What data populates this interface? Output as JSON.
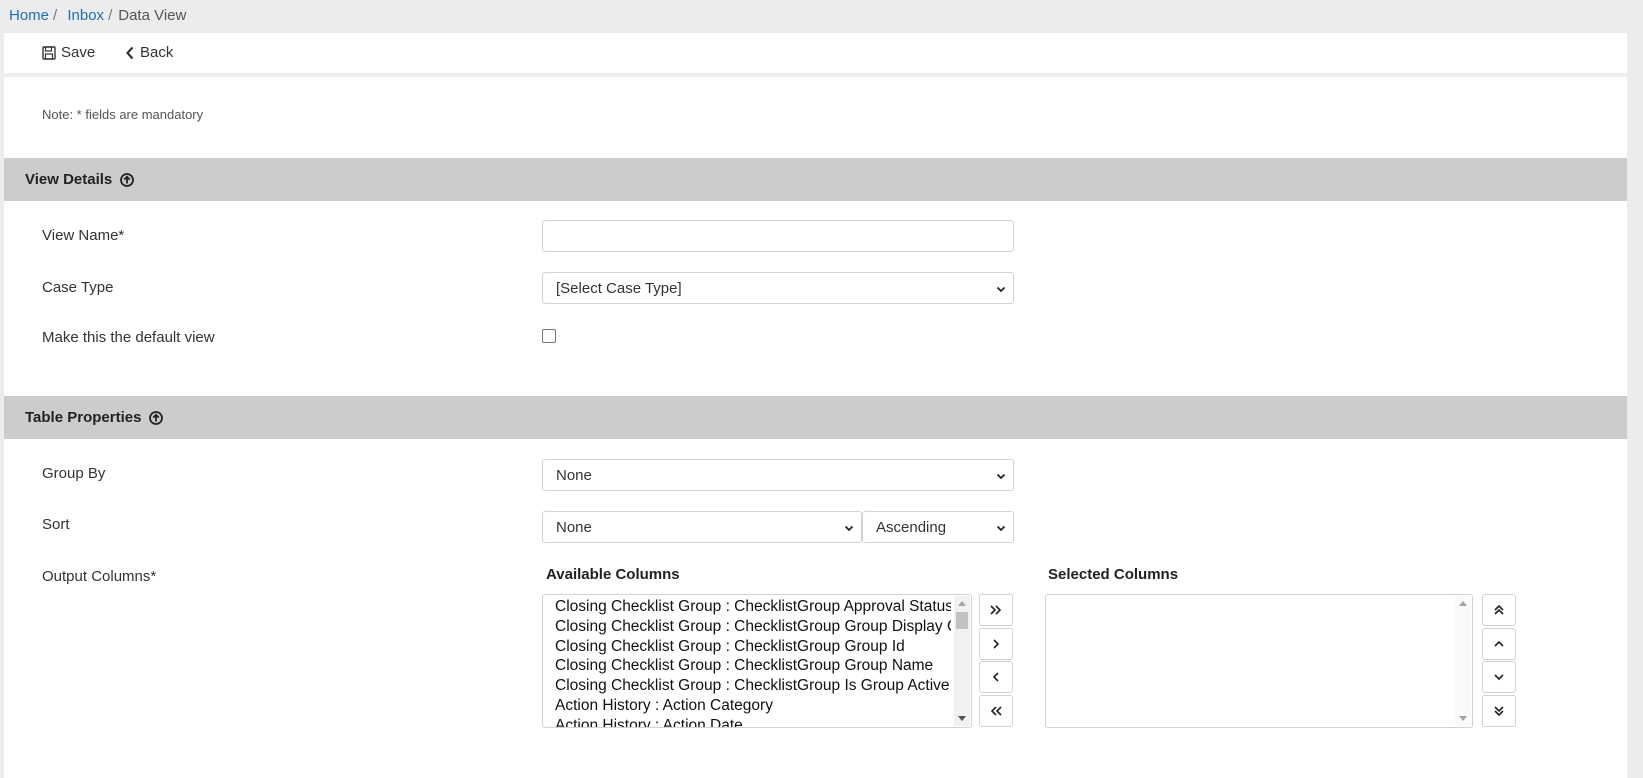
{
  "breadcrumb": {
    "home": "Home",
    "inbox": "Inbox",
    "current": "Data View",
    "sep": "/"
  },
  "toolbar": {
    "save_label": "Save",
    "back_label": "Back"
  },
  "note": "Note: * fields are mandatory",
  "view_details": {
    "title": "View Details",
    "view_name_label": "View Name*",
    "view_name_value": "",
    "case_type_label": "Case Type",
    "case_type_value": "[Select Case Type]",
    "default_view_label": "Make this the default view",
    "default_view_checked": false
  },
  "table_properties": {
    "title": "Table Properties",
    "group_by_label": "Group By",
    "group_by_value": "None",
    "sort_label": "Sort",
    "sort_field_value": "None",
    "sort_order_value": "Ascending",
    "output_columns_label": "Output Columns*",
    "available_columns_label": "Available Columns",
    "selected_columns_label": "Selected Columns",
    "available_columns": [
      "Closing Checklist Group : ChecklistGroup Approval Status",
      "Closing Checklist Group : ChecklistGroup Group Display Order",
      "Closing Checklist Group : ChecklistGroup Group Id",
      "Closing Checklist Group : ChecklistGroup Group Name",
      "Closing Checklist Group : ChecklistGroup Is Group Active",
      "Action History : Action Category",
      "Action History : Action Date"
    ],
    "selected_columns": []
  },
  "icons": {
    "save": "floppy-disk-icon",
    "back": "chevron-left-icon",
    "collapse": "circle-arrow-up-icon"
  }
}
